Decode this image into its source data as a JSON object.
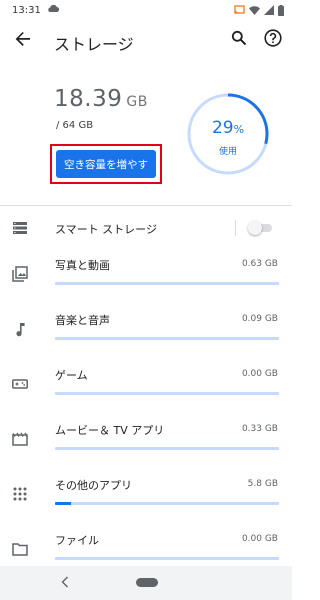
{
  "status_bar": {
    "time": "13:31",
    "icons": [
      "cloud-icon",
      "cast-icon",
      "wifi-icon",
      "signal-icon",
      "battery-icon"
    ]
  },
  "app_bar": {
    "title": "ストレージ",
    "back_icon": "arrow-back-icon",
    "search_icon": "search-icon",
    "help_icon": "help-icon"
  },
  "storage": {
    "used_value": "18.39",
    "used_unit": "GB",
    "total": "/ 64 GB",
    "free_button_label": "空き容量を増やす",
    "percent_value": "29",
    "percent_sign": "%",
    "percent_label": "使用",
    "percent_fraction": 0.29
  },
  "smart_storage": {
    "label": "スマート ストレージ",
    "icon": "smart-storage-icon",
    "enabled": false
  },
  "categories": [
    {
      "label": "写真と動画",
      "size": "0.63 GB",
      "icon": "photos-icon",
      "fill": 0.0
    },
    {
      "label": "音楽と音声",
      "size": "0.09 GB",
      "icon": "music-note-icon",
      "fill": 0.0
    },
    {
      "label": "ゲーム",
      "size": "0.00 GB",
      "icon": "gamepad-icon",
      "fill": 0.0
    },
    {
      "label": "ムービー＆ TV アプリ",
      "size": "0.33 GB",
      "icon": "movie-icon",
      "fill": 0.0
    },
    {
      "label": "その他のアプリ",
      "size": "5.8 GB",
      "icon": "apps-grid-icon",
      "fill": 0.07
    },
    {
      "label": "ファイル",
      "size": "0.00 GB",
      "icon": "folder-icon",
      "fill": 0.0
    }
  ],
  "colors": {
    "accent": "#1a73e8",
    "bar_track": "#c6dafc",
    "highlight_border": "#e3001b"
  }
}
